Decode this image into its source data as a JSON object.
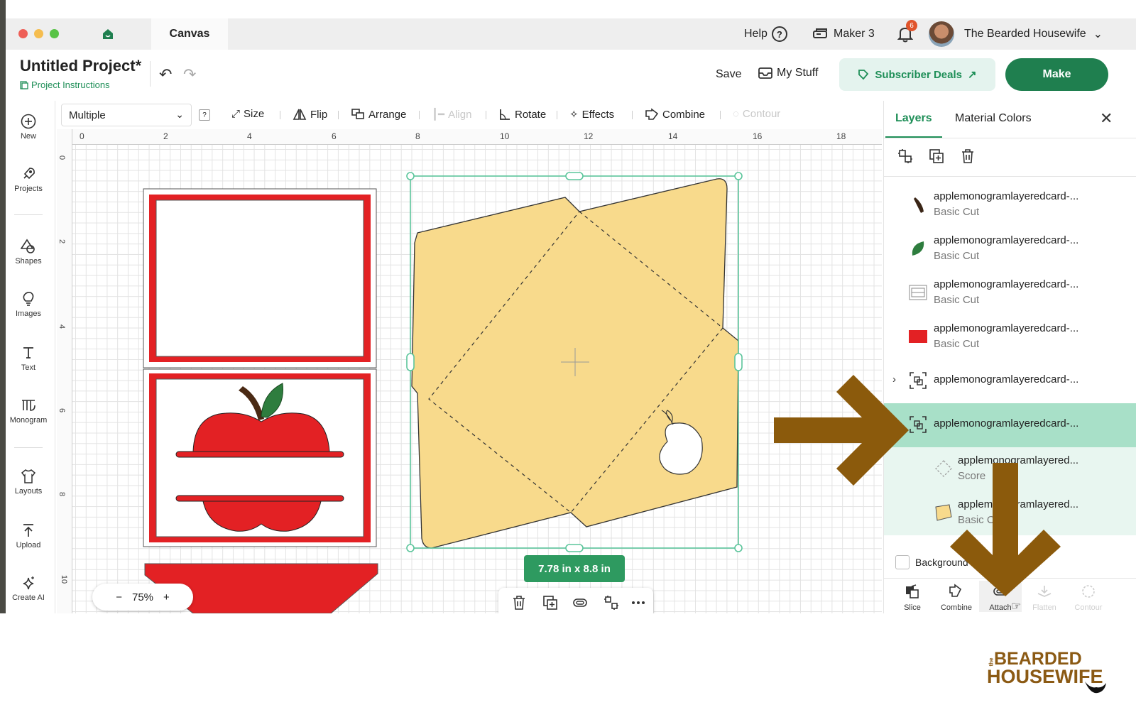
{
  "window": {
    "tab_label": "Canvas",
    "help_label": "Help",
    "machine_label": "Maker 3",
    "notification_count": "6",
    "account_name": "The Bearded Housewife"
  },
  "project": {
    "title": "Untitled Project*",
    "instructions_label": "Project Instructions"
  },
  "header_actions": {
    "save_label": "Save",
    "mystuff_label": "My Stuff",
    "subscriber_label": "Subscriber Deals",
    "make_label": "Make"
  },
  "sidebar": {
    "items": [
      {
        "label": "New",
        "icon": "plus-circle-icon"
      },
      {
        "label": "Projects",
        "icon": "rocket-icon"
      },
      {
        "label": "Shapes",
        "icon": "shapes-icon"
      },
      {
        "label": "Images",
        "icon": "lightbulb-icon"
      },
      {
        "label": "Text",
        "icon": "text-icon"
      },
      {
        "label": "Monogram",
        "icon": "monogram-icon"
      },
      {
        "label": "Layouts",
        "icon": "shirt-icon"
      },
      {
        "label": "Upload",
        "icon": "upload-icon"
      },
      {
        "label": "Create AI",
        "icon": "sparkle-icon"
      }
    ]
  },
  "toolbar": {
    "selection_value": "Multiple",
    "help_glyph": "?",
    "size_label": "Size",
    "flip_label": "Flip",
    "arrange_label": "Arrange",
    "align_label": "Align",
    "rotate_label": "Rotate",
    "effects_label": "Effects",
    "combine_label": "Combine",
    "contour_label": "Contour"
  },
  "canvas": {
    "ruler_top": [
      "0",
      "2",
      "4",
      "6",
      "8",
      "10",
      "12",
      "14",
      "16",
      "18"
    ],
    "ruler_left": [
      "0",
      "2",
      "4",
      "6",
      "8",
      "10"
    ],
    "zoom_minus": "−",
    "zoom_value": "75%",
    "zoom_plus": "+",
    "selection_size": "7.78  in x 8.8  in"
  },
  "panel": {
    "tab_layers": "Layers",
    "tab_material_colors": "Material Colors",
    "layers": [
      {
        "title": "applemonogramlayeredcard-...",
        "subtitle": "Basic Cut",
        "thumb": "brown-stem"
      },
      {
        "title": "applemonogramlayeredcard-...",
        "subtitle": "Basic Cut",
        "thumb": "green-leaf"
      },
      {
        "title": "applemonogramlayeredcard-...",
        "subtitle": "Basic Cut",
        "thumb": "white-card"
      },
      {
        "title": "applemonogramlayeredcard-...",
        "subtitle": "Basic Cut",
        "thumb": "red-rect"
      },
      {
        "title": "applemonogramlayeredcard-...",
        "subtitle": "",
        "thumb": "group"
      },
      {
        "title": "applemonogramlayeredcard-...",
        "subtitle": "",
        "thumb": "group"
      }
    ],
    "children": [
      {
        "title": "applemonogramlayered...",
        "subtitle": "Score"
      },
      {
        "title": "applemonogramlayered...",
        "subtitle": "Basic Cut"
      }
    ],
    "background_label": "Background Color",
    "bottom_tools": [
      "Slice",
      "Combine",
      "Attach",
      "Flatten",
      "Contour"
    ]
  },
  "brand": {
    "logo_the": "the",
    "logo_line1": "BEARDED",
    "logo_line2": "HOUSEWIFE"
  },
  "colors": {
    "accent_green": "#1f7f4f",
    "card_red": "#e32124",
    "envelope_yellow": "#f8da8c",
    "arrow_brown": "#8b5a0c",
    "selection_green": "#5bc59b"
  }
}
